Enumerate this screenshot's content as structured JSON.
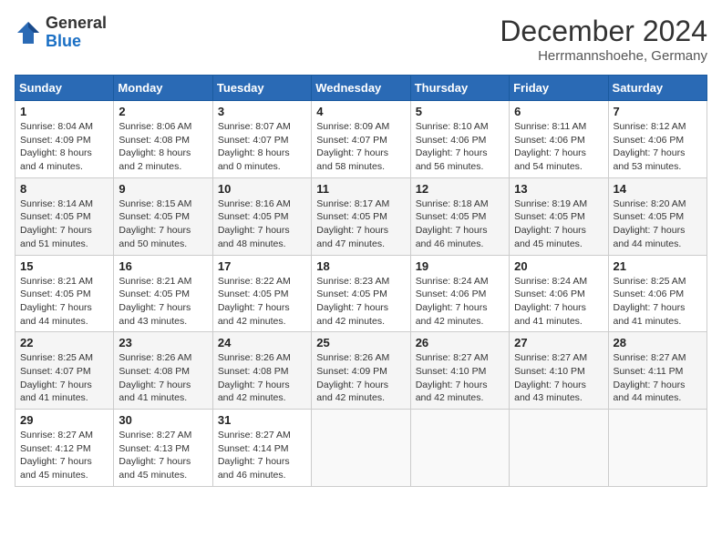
{
  "header": {
    "logo_general": "General",
    "logo_blue": "Blue",
    "month_title": "December 2024",
    "location": "Herrmannshoehe, Germany"
  },
  "calendar": {
    "headers": [
      "Sunday",
      "Monday",
      "Tuesday",
      "Wednesday",
      "Thursday",
      "Friday",
      "Saturday"
    ],
    "weeks": [
      [
        {
          "day": "1",
          "sunrise": "Sunrise: 8:04 AM",
          "sunset": "Sunset: 4:09 PM",
          "daylight": "Daylight: 8 hours and 4 minutes."
        },
        {
          "day": "2",
          "sunrise": "Sunrise: 8:06 AM",
          "sunset": "Sunset: 4:08 PM",
          "daylight": "Daylight: 8 hours and 2 minutes."
        },
        {
          "day": "3",
          "sunrise": "Sunrise: 8:07 AM",
          "sunset": "Sunset: 4:07 PM",
          "daylight": "Daylight: 8 hours and 0 minutes."
        },
        {
          "day": "4",
          "sunrise": "Sunrise: 8:09 AM",
          "sunset": "Sunset: 4:07 PM",
          "daylight": "Daylight: 7 hours and 58 minutes."
        },
        {
          "day": "5",
          "sunrise": "Sunrise: 8:10 AM",
          "sunset": "Sunset: 4:06 PM",
          "daylight": "Daylight: 7 hours and 56 minutes."
        },
        {
          "day": "6",
          "sunrise": "Sunrise: 8:11 AM",
          "sunset": "Sunset: 4:06 PM",
          "daylight": "Daylight: 7 hours and 54 minutes."
        },
        {
          "day": "7",
          "sunrise": "Sunrise: 8:12 AM",
          "sunset": "Sunset: 4:06 PM",
          "daylight": "Daylight: 7 hours and 53 minutes."
        }
      ],
      [
        {
          "day": "8",
          "sunrise": "Sunrise: 8:14 AM",
          "sunset": "Sunset: 4:05 PM",
          "daylight": "Daylight: 7 hours and 51 minutes."
        },
        {
          "day": "9",
          "sunrise": "Sunrise: 8:15 AM",
          "sunset": "Sunset: 4:05 PM",
          "daylight": "Daylight: 7 hours and 50 minutes."
        },
        {
          "day": "10",
          "sunrise": "Sunrise: 8:16 AM",
          "sunset": "Sunset: 4:05 PM",
          "daylight": "Daylight: 7 hours and 48 minutes."
        },
        {
          "day": "11",
          "sunrise": "Sunrise: 8:17 AM",
          "sunset": "Sunset: 4:05 PM",
          "daylight": "Daylight: 7 hours and 47 minutes."
        },
        {
          "day": "12",
          "sunrise": "Sunrise: 8:18 AM",
          "sunset": "Sunset: 4:05 PM",
          "daylight": "Daylight: 7 hours and 46 minutes."
        },
        {
          "day": "13",
          "sunrise": "Sunrise: 8:19 AM",
          "sunset": "Sunset: 4:05 PM",
          "daylight": "Daylight: 7 hours and 45 minutes."
        },
        {
          "day": "14",
          "sunrise": "Sunrise: 8:20 AM",
          "sunset": "Sunset: 4:05 PM",
          "daylight": "Daylight: 7 hours and 44 minutes."
        }
      ],
      [
        {
          "day": "15",
          "sunrise": "Sunrise: 8:21 AM",
          "sunset": "Sunset: 4:05 PM",
          "daylight": "Daylight: 7 hours and 44 minutes."
        },
        {
          "day": "16",
          "sunrise": "Sunrise: 8:21 AM",
          "sunset": "Sunset: 4:05 PM",
          "daylight": "Daylight: 7 hours and 43 minutes."
        },
        {
          "day": "17",
          "sunrise": "Sunrise: 8:22 AM",
          "sunset": "Sunset: 4:05 PM",
          "daylight": "Daylight: 7 hours and 42 minutes."
        },
        {
          "day": "18",
          "sunrise": "Sunrise: 8:23 AM",
          "sunset": "Sunset: 4:05 PM",
          "daylight": "Daylight: 7 hours and 42 minutes."
        },
        {
          "day": "19",
          "sunrise": "Sunrise: 8:24 AM",
          "sunset": "Sunset: 4:06 PM",
          "daylight": "Daylight: 7 hours and 42 minutes."
        },
        {
          "day": "20",
          "sunrise": "Sunrise: 8:24 AM",
          "sunset": "Sunset: 4:06 PM",
          "daylight": "Daylight: 7 hours and 41 minutes."
        },
        {
          "day": "21",
          "sunrise": "Sunrise: 8:25 AM",
          "sunset": "Sunset: 4:06 PM",
          "daylight": "Daylight: 7 hours and 41 minutes."
        }
      ],
      [
        {
          "day": "22",
          "sunrise": "Sunrise: 8:25 AM",
          "sunset": "Sunset: 4:07 PM",
          "daylight": "Daylight: 7 hours and 41 minutes."
        },
        {
          "day": "23",
          "sunrise": "Sunrise: 8:26 AM",
          "sunset": "Sunset: 4:08 PM",
          "daylight": "Daylight: 7 hours and 41 minutes."
        },
        {
          "day": "24",
          "sunrise": "Sunrise: 8:26 AM",
          "sunset": "Sunset: 4:08 PM",
          "daylight": "Daylight: 7 hours and 42 minutes."
        },
        {
          "day": "25",
          "sunrise": "Sunrise: 8:26 AM",
          "sunset": "Sunset: 4:09 PM",
          "daylight": "Daylight: 7 hours and 42 minutes."
        },
        {
          "day": "26",
          "sunrise": "Sunrise: 8:27 AM",
          "sunset": "Sunset: 4:10 PM",
          "daylight": "Daylight: 7 hours and 42 minutes."
        },
        {
          "day": "27",
          "sunrise": "Sunrise: 8:27 AM",
          "sunset": "Sunset: 4:10 PM",
          "daylight": "Daylight: 7 hours and 43 minutes."
        },
        {
          "day": "28",
          "sunrise": "Sunrise: 8:27 AM",
          "sunset": "Sunset: 4:11 PM",
          "daylight": "Daylight: 7 hours and 44 minutes."
        }
      ],
      [
        {
          "day": "29",
          "sunrise": "Sunrise: 8:27 AM",
          "sunset": "Sunset: 4:12 PM",
          "daylight": "Daylight: 7 hours and 45 minutes."
        },
        {
          "day": "30",
          "sunrise": "Sunrise: 8:27 AM",
          "sunset": "Sunset: 4:13 PM",
          "daylight": "Daylight: 7 hours and 45 minutes."
        },
        {
          "day": "31",
          "sunrise": "Sunrise: 8:27 AM",
          "sunset": "Sunset: 4:14 PM",
          "daylight": "Daylight: 7 hours and 46 minutes."
        },
        null,
        null,
        null,
        null
      ]
    ]
  }
}
